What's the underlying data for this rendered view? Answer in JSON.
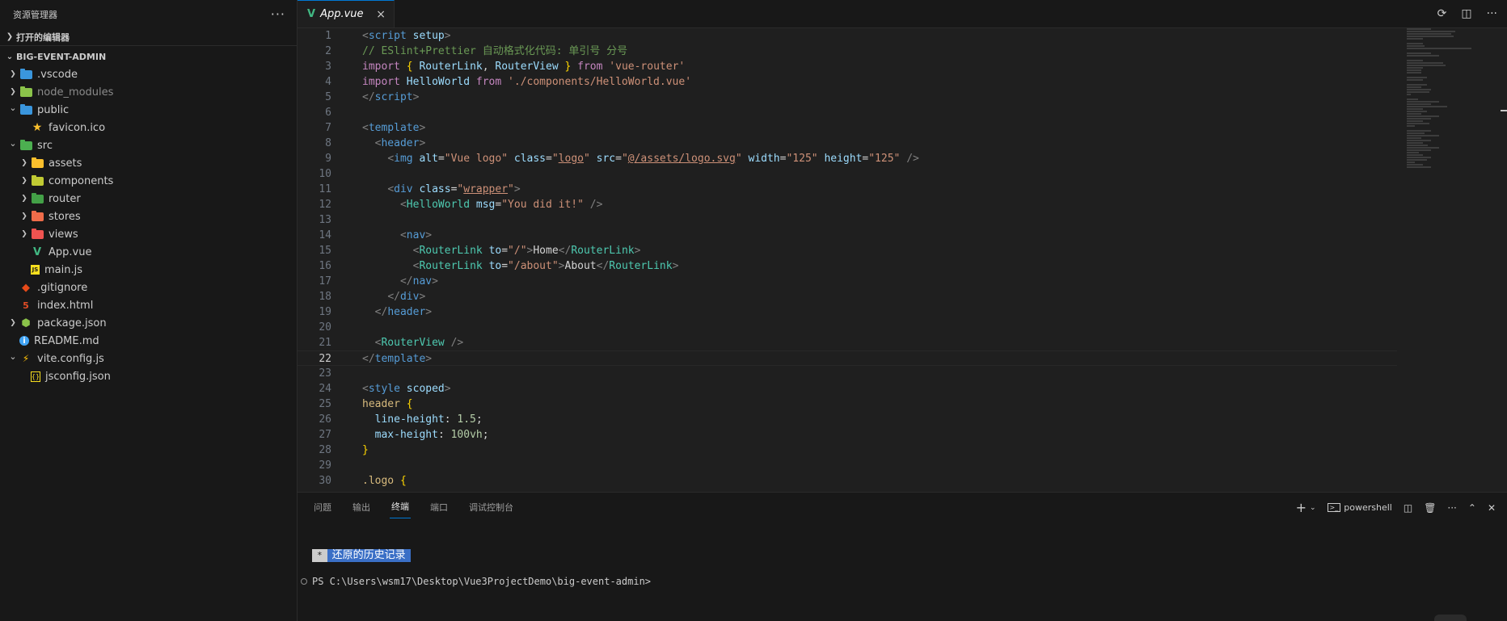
{
  "sidebar": {
    "title": "资源管理器",
    "more": "···",
    "open_editors": "打开的编辑器",
    "project": "BIG-EVENT-ADMIN",
    "items": [
      {
        "label": ".vscode",
        "icon": "folder-vscode-icon",
        "color": "#3a96dd",
        "level": 0,
        "chevron": "right",
        "dim": false
      },
      {
        "label": "node_modules",
        "icon": "folder-node-icon",
        "color": "#8bc34a",
        "level": 0,
        "chevron": "right",
        "dim": true
      },
      {
        "label": "public",
        "icon": "folder-public-icon",
        "color": "#3a96dd",
        "level": 0,
        "chevron": "down",
        "dim": false
      },
      {
        "label": "favicon.ico",
        "icon": "star-icon",
        "color": "#fbc02d",
        "level": 1,
        "chevron": "",
        "dim": false
      },
      {
        "label": "src",
        "icon": "folder-src-icon",
        "color": "#4caf50",
        "level": 0,
        "chevron": "down",
        "dim": false
      },
      {
        "label": "assets",
        "icon": "folder-assets-icon",
        "color": "#fbc02d",
        "level": 1,
        "chevron": "right",
        "dim": false
      },
      {
        "label": "components",
        "icon": "folder-components-icon",
        "color": "#c0ca33",
        "level": 1,
        "chevron": "right",
        "dim": false
      },
      {
        "label": "router",
        "icon": "folder-router-icon",
        "color": "#43a047",
        "level": 1,
        "chevron": "right",
        "dim": false
      },
      {
        "label": "stores",
        "icon": "folder-stores-icon",
        "color": "#ef6c4a",
        "level": 1,
        "chevron": "right",
        "dim": false
      },
      {
        "label": "views",
        "icon": "folder-views-icon",
        "color": "#ef5350",
        "level": 1,
        "chevron": "right",
        "dim": false
      },
      {
        "label": "App.vue",
        "icon": "vue-icon",
        "color": "#41b883",
        "level": 1,
        "chevron": "",
        "dim": false
      },
      {
        "label": "main.js",
        "icon": "js-icon",
        "color": "#f7df1e",
        "level": 1,
        "chevron": "",
        "dim": false
      },
      {
        "label": ".gitignore",
        "icon": "git-icon",
        "color": "#e64a19",
        "level": 0,
        "chevron": "",
        "dim": false
      },
      {
        "label": "index.html",
        "icon": "html-icon",
        "color": "#e44d26",
        "level": 0,
        "chevron": "",
        "dim": false
      },
      {
        "label": "package.json",
        "icon": "nodejs-icon",
        "color": "#8bc34a",
        "level": 0,
        "chevron": "right",
        "dim": false
      },
      {
        "label": "README.md",
        "icon": "info-icon",
        "color": "#42a5f5",
        "level": 0,
        "chevron": "",
        "dim": false
      },
      {
        "label": "vite.config.js",
        "icon": "vite-icon",
        "color": "#ffc107",
        "level": 0,
        "chevron": "down",
        "dim": false
      },
      {
        "label": "jsconfig.json",
        "icon": "jsconfig-icon",
        "color": "#f7df1e",
        "level": 1,
        "chevron": "",
        "dim": false
      }
    ]
  },
  "editor": {
    "tab_label": "App.vue",
    "tab_close": "×",
    "current_line": 22
  },
  "panel": {
    "tabs": [
      "问题",
      "输出",
      "终端",
      "端口",
      "调试控制台"
    ],
    "active_tab": "终端",
    "shell": "powershell",
    "restore_star": "*",
    "restore_text": "还原的历史记录",
    "prompt": "PS C:\\Users\\wsm17\\Desktop\\Vue3ProjectDemo\\big-event-admin>"
  },
  "colors": {
    "accent": "#0078d4",
    "vue_green": "#41b883",
    "restore_bg": "#3a6fc6"
  }
}
